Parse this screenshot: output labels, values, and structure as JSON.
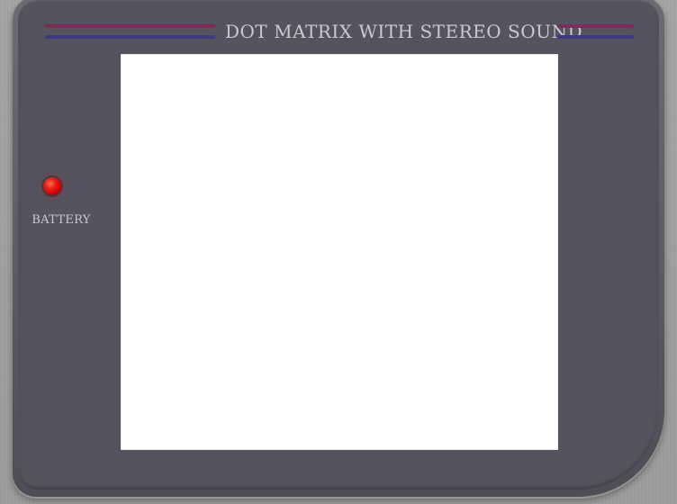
{
  "bezel": {
    "title": "DOT MATRIX WITH STEREO SOUND",
    "stripe_colors": {
      "upper": "#7d2d5a",
      "lower": "#3c3b80"
    },
    "panel_color": "#54535f",
    "text_color": "#c9c9d2"
  },
  "battery": {
    "label": "BATTERY",
    "led_color": "#ee1a12",
    "icon": "battery-led-icon"
  },
  "screen": {
    "background": "#ffffff"
  }
}
